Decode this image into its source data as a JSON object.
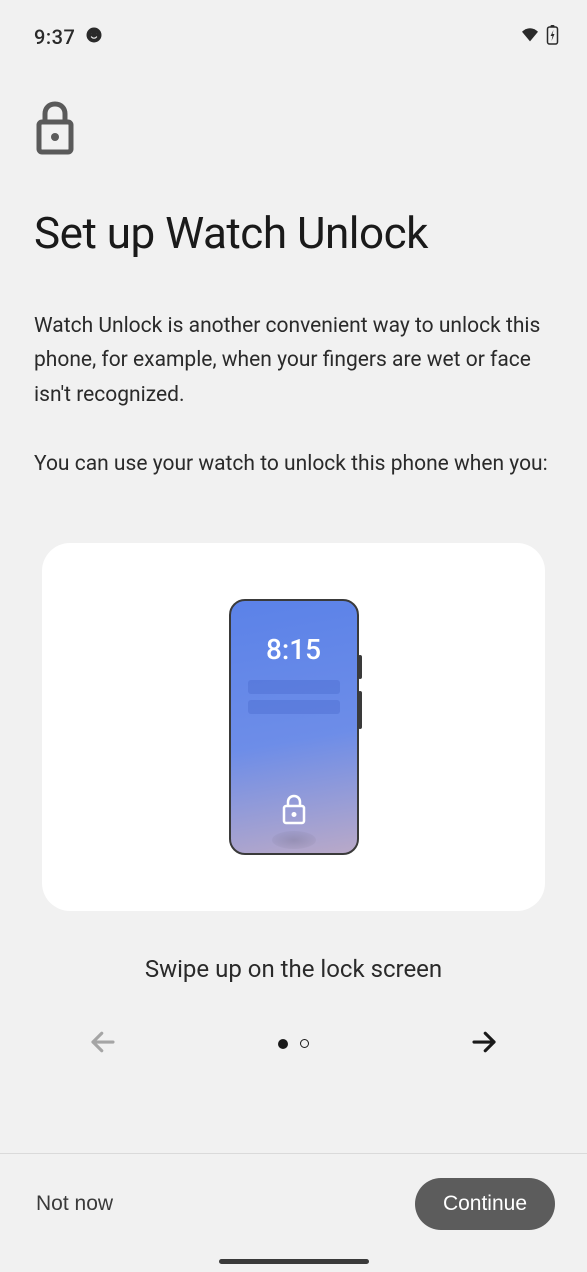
{
  "status": {
    "time": "9:37"
  },
  "header": {
    "title": "Set up Watch Unlock"
  },
  "body": {
    "paragraph1": "Watch Unlock is another convenient way to unlock this phone, for example, when your fingers are wet or face isn't recognized.",
    "paragraph2": "You can use your watch to unlock this phone when you:"
  },
  "illustration": {
    "phone_time": "8:15",
    "caption": "Swipe up on the lock screen"
  },
  "pager": {
    "current": 1,
    "total": 2
  },
  "footer": {
    "secondary": "Not now",
    "primary": "Continue"
  }
}
